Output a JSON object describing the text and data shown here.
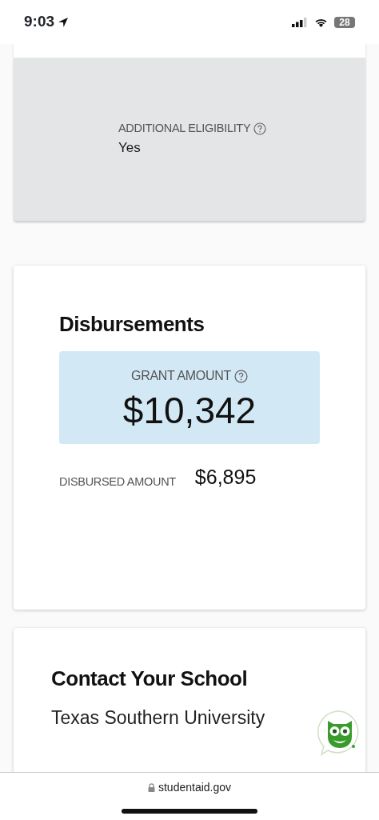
{
  "status_bar": {
    "time": "9:03",
    "battery": "28"
  },
  "eligibility": {
    "label": "ADDITIONAL ELIGIBILITY",
    "value": "Yes"
  },
  "disbursements": {
    "title": "Disbursements",
    "grant_label": "GRANT AMOUNT",
    "grant_value": "$10,342",
    "disbursed_label": "DISBURSED AMOUNT",
    "disbursed_value": "$6,895"
  },
  "contact": {
    "title": "Contact Your School",
    "school": "Texas Southern University"
  },
  "address_bar": {
    "url": "studentaid.gov"
  }
}
